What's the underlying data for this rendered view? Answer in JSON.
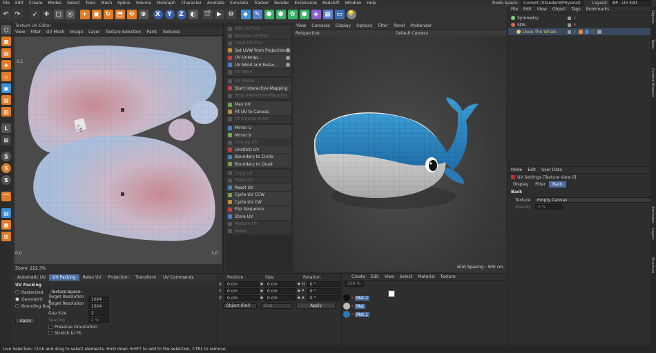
{
  "menubar": {
    "items": [
      "File",
      "Edit",
      "Create",
      "Modes",
      "Select",
      "Tools",
      "Mesh",
      "Spline",
      "Volume",
      "MoGraph",
      "Character",
      "Animate",
      "Simulate",
      "Tracker",
      "Render",
      "Extensions",
      "Redshift",
      "Window",
      "Help"
    ],
    "node_space_label": "Node Space:",
    "node_space_value": "Current (Standard/Physical)",
    "layout_label": "Layout:",
    "layout_value": "BP - UV Edit"
  },
  "toolbar": {
    "axis_x": "X",
    "axis_y": "Y",
    "axis_z": "Z"
  },
  "uv_editor": {
    "title": "Texture UV Editor",
    "menu": [
      "View",
      "Filter",
      "UV Mesh",
      "Image",
      "Layer",
      "Texture Selection",
      "Paint",
      "Textures"
    ],
    "axis_top": "0,1",
    "axis_origin": "0,0",
    "axis_right": "1,0",
    "zoom": "Zoom: 222.3%"
  },
  "commands": [
    {
      "label": "Add UV Pins",
      "enabled": false,
      "gear": false
    },
    {
      "label": "Remove UV Pins",
      "enabled": false,
      "gear": false
    },
    {
      "label": "Clear UV Pins",
      "enabled": false,
      "gear": false
    },
    {
      "label": "Set UVW from Projection...",
      "enabled": true,
      "gear": true
    },
    {
      "label": "UV Unwrap...",
      "enabled": true,
      "gear": true
    },
    {
      "label": "UV Weld and Relax...",
      "enabled": true,
      "gear": true
    },
    {
      "label": "UV Weld",
      "enabled": false,
      "gear": false
    },
    {
      "label": "UV Peeler",
      "enabled": false,
      "gear": false
    },
    {
      "label": "Start Interactive Mapping",
      "enabled": true,
      "gear": false
    },
    {
      "label": "Stop Interactive Mapping",
      "enabled": false,
      "gear": false
    },
    {
      "label": "Max UV",
      "enabled": true,
      "gear": false
    },
    {
      "label": "Fit UV to Canvas",
      "enabled": true,
      "gear": false
    },
    {
      "label": "Fit Canvas to UV",
      "enabled": false,
      "gear": false
    },
    {
      "label": "Mirror U",
      "enabled": true,
      "gear": false
    },
    {
      "label": "Mirror V",
      "enabled": true,
      "gear": false
    },
    {
      "label": "Line Up UV",
      "enabled": false,
      "gear": false
    },
    {
      "label": "Unstitch UV",
      "enabled": true,
      "gear": false
    },
    {
      "label": "Boundary to Circle",
      "enabled": true,
      "gear": false
    },
    {
      "label": "Boundary to Quad",
      "enabled": true,
      "gear": false
    },
    {
      "label": "Copy UV",
      "enabled": false,
      "gear": false
    },
    {
      "label": "Paste UV",
      "enabled": false,
      "gear": false
    },
    {
      "label": "Reset UV",
      "enabled": true,
      "gear": false
    },
    {
      "label": "Cycle UV CCW",
      "enabled": true,
      "gear": false
    },
    {
      "label": "Cycle UV CW",
      "enabled": true,
      "gear": false
    },
    {
      "label": "Flip Sequence",
      "enabled": true,
      "gear": false
    },
    {
      "label": "Store UV",
      "enabled": true,
      "gear": false
    },
    {
      "label": "Restore UV",
      "enabled": false,
      "gear": false
    },
    {
      "label": "Relax...",
      "enabled": false,
      "gear": false
    }
  ],
  "viewport": {
    "menu": [
      "View",
      "Cameras",
      "Display",
      "Options",
      "Filter",
      "Panel",
      "ProRender"
    ],
    "label": "Perspective",
    "camera": "Default Camera",
    "grid_spacing": "Grid Spacing : 500 cm"
  },
  "object_manager": {
    "menu": [
      "File",
      "Edit",
      "View",
      "Object",
      "Tags",
      "Bookmarks"
    ],
    "objects": [
      {
        "name": "Symmetry",
        "color": "#7fd37f",
        "indent": 0
      },
      {
        "name": "SDS",
        "color": "#d66a4f",
        "indent": 0
      },
      {
        "name": "Uvee The Whale",
        "color": "#e0c46c",
        "indent": 1
      }
    ]
  },
  "attributes": {
    "menu": [
      "Mode",
      "Edit",
      "User Data"
    ],
    "title": "UV Settings [Texture View 0]",
    "tabs": [
      "Display",
      "Filter",
      "Back"
    ],
    "section": "Back",
    "texture_label": "Texture",
    "texture_value": "Empty Canvas",
    "opacity_label": "Opacity",
    "opacity_value": "0 %"
  },
  "uv_tools": {
    "tabs": [
      "Automatic UV",
      "UV Packing",
      "Relax UV",
      "Projection",
      "Transform",
      "UV Commands"
    ],
    "active_tab": 1,
    "section": "UV Packing",
    "radio_options": [
      "Rasterized",
      "Geometric",
      "Bounding Box"
    ],
    "selected_radio": 1,
    "texture_space": "Texture Space",
    "target_res_x_label": "Target Resolution X",
    "target_res_x": "1024",
    "target_res_y_label": "Target Resolution Y",
    "target_res_y": "1024",
    "gap_size_label": "Gap Size",
    "gap_size": "2",
    "spacing_label": "Spacing",
    "spacing": "2 %",
    "preserve_orientation": "Preserve Orientation",
    "stretch_to_fit": "Stretch to Fit",
    "apply_label": "Apply"
  },
  "coordinates": {
    "headers": [
      "Position",
      "Size",
      "Rotation"
    ],
    "rows": [
      {
        "axis": "X",
        "pos": "0 cm",
        "size": "0 cm",
        "rot_axis": "H",
        "rot": "0 °"
      },
      {
        "axis": "Y",
        "pos": "0 cm",
        "size": "0 cm",
        "rot_axis": "P",
        "rot": "0 °"
      },
      {
        "axis": "Z",
        "pos": "0 cm",
        "size": "0 cm",
        "rot_axis": "B",
        "rot": "0 °"
      }
    ],
    "mode": "Object (Rel)",
    "size_mode": "Size",
    "apply_label": "Apply"
  },
  "materials": {
    "menu": [
      "Create",
      "Edit",
      "View",
      "Select",
      "Material",
      "Texture"
    ],
    "zoom": "100 %",
    "items": [
      "Mat.2",
      "Mat",
      "Mat.1"
    ]
  },
  "status": "Live Selection: Click and drag to select elements. Hold down SHIFT to add to the selection, CTRL to remove.",
  "right_tabs": [
    "Objects",
    "Takes",
    "Content Browser",
    "Attributes",
    "Layers",
    "Structure"
  ]
}
